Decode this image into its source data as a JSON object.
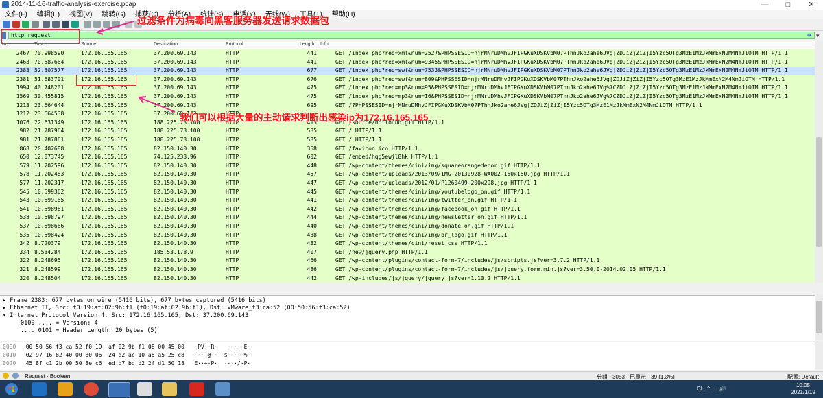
{
  "window": {
    "title": "2014-11-16-traffic-analysis-exercise.pcap",
    "controls": [
      "—",
      "□",
      "✕"
    ]
  },
  "menu": [
    "文件(F)",
    "编辑(E)",
    "视图(V)",
    "跳转(G)",
    "捕获(C)",
    "分析(A)",
    "统计(S)",
    "电话(Y)",
    "无线(W)",
    "工具(T)",
    "帮助(H)"
  ],
  "filter": {
    "value": "http request",
    "apply_icon": "arrow-right-icon",
    "dropdown_icon": "chevron-down-icon"
  },
  "columns": {
    "no": "No.",
    "time": "Time",
    "source": "Source",
    "destination": "Destination",
    "protocol": "Protocol",
    "length": "Length",
    "info": "Info"
  },
  "packets": [
    {
      "no": "2467",
      "time": "70.998590",
      "src": "172.16.165.165",
      "dst": "37.200.69.143",
      "proto": "HTTP",
      "len": "441",
      "info": "GET /index.php?req=xml&num=2527&PHPSSESID=njrMNruDMhvJFIPGKuXDSKVbM07PThnJko2ahe6JVg|ZDJiZjZiZjI5Yzc5OTg3MzE1MzJkMmExN2M4NmJiOTM HTTP/1.1"
    },
    {
      "no": "2463",
      "time": "70.587664",
      "src": "172.16.165.165",
      "dst": "37.200.69.143",
      "proto": "HTTP",
      "len": "441",
      "info": "GET /index.php?req=xml&num=9345&PHPSSESID=njrMNruDMhvJFIPGKuXDSKVbM07PThnJko2ahe6JVg|ZDJiZjZiZjI5Yzc5OTg3MzE1MzJkMmExN2M4NmJiOTM HTTP/1.1"
    },
    {
      "no": "2383",
      "time": "52.307577",
      "src": "172.16.165.165",
      "dst": "37.200.69.143",
      "proto": "HTTP",
      "len": "677",
      "info": "GET /index.php?req=swf&num=7533&PHPSSESID=njrMNruDMhvJFIPGKuXDSKVbM07PThnJko2ahe6JVg|ZDJiZjZiZjI5Yzc5OTg3MzE1MzJkMmExN2M4NmJiOTM HTTP/1.1"
    },
    {
      "no": "2381",
      "time": "51.683701",
      "src": "172.16.165.165",
      "dst": "37.200.69.143",
      "proto": "HTTP",
      "len": "676",
      "info": "GET /index.php?req=swf&num=809&PHPSSESID=njrMNruDMhvJFIPGKuXDSKVbM07PThnJko2ahe6JVg|ZDJiZjZiZjI5Yzc5OTg3MzE1MzJkMmExN2M4NmJiOTM HTTP/1.1"
    },
    {
      "no": "1994",
      "time": "40.748201",
      "src": "172.16.165.165",
      "dst": "37.200.69.143",
      "proto": "HTTP",
      "len": "475",
      "info": "GET /index.php?req=mp3&num=95&PHPSSESID=njrMNruDMhvJFIPGKuXDSKVbM07PThnJko2ahe6JVg%7CZDJiZjZiZjI5Yzc5OTg3MzE1MzJkMmExN2M4NmJiOTM HTTP/1.1"
    },
    {
      "no": "1569",
      "time": "30.455815",
      "src": "172.16.165.165",
      "dst": "37.200.69.143",
      "proto": "HTTP",
      "len": "475",
      "info": "GET /index.php?req=mp3&num=16&PHPSSESID=njrMNruDMhvJFIPGKuXDSKVbM07PThnJko2ahe6JVg%7CZDJiZjZiZjI5Yzc5OTg3MzE1MzJkMmExN2M4NmJiOTM HTTP/1.1"
    },
    {
      "no": "1213",
      "time": "23.664644",
      "src": "172.16.165.165",
      "dst": "37.200.69.143",
      "proto": "HTTP",
      "len": "695",
      "info": "GET /?PHPSSESID=njrMNruDMhvJFIPGKuXDSKVbM07PThnJko2ahe6JVg|ZDJiZjZiZjI5Yzc5OTg3MzE1MzJkMmExN2M4NmJiOTM HTTP/1.1"
    },
    {
      "no": "1212",
      "time": "23.664538",
      "src": "172.16.165.165",
      "dst": "37.200.69.143",
      "proto": "HTTP",
      "len": "",
      "info": ""
    },
    {
      "no": "1076",
      "time": "22.631349",
      "src": "172.16.165.165",
      "dst": "188.225.73.100",
      "proto": "HTTP",
      "len": "413",
      "info": "GET /source/notfound.gif HTTP/1.1"
    },
    {
      "no": "982",
      "time": "21.787964",
      "src": "172.16.165.165",
      "dst": "188.225.73.100",
      "proto": "HTTP",
      "len": "585",
      "info": "GET / HTTP/1.1"
    },
    {
      "no": "981",
      "time": "21.787861",
      "src": "172.16.165.165",
      "dst": "188.225.73.100",
      "proto": "HTTP",
      "len": "585",
      "info": "GET / HTTP/1.1"
    },
    {
      "no": "868",
      "time": "20.402688",
      "src": "172.16.165.165",
      "dst": "82.150.140.30",
      "proto": "HTTP",
      "len": "358",
      "info": "GET /favicon.ico HTTP/1.1"
    },
    {
      "no": "650",
      "time": "12.073745",
      "src": "172.16.165.165",
      "dst": "74.125.233.96",
      "proto": "HTTP",
      "len": "602",
      "info": "GET /embed/hqg5ewjl8hk HTTP/1.1"
    },
    {
      "no": "579",
      "time": "11.202596",
      "src": "172.16.165.165",
      "dst": "82.150.140.30",
      "proto": "HTTP",
      "len": "448",
      "info": "GET /wp-content/themes/cini/img/squareorangedecor.gif HTTP/1.1"
    },
    {
      "no": "578",
      "time": "11.202483",
      "src": "172.16.165.165",
      "dst": "82.150.140.30",
      "proto": "HTTP",
      "len": "457",
      "info": "GET /wp-content/uploads/2013/09/IMG-20130928-WA002-150x150.jpg HTTP/1.1"
    },
    {
      "no": "577",
      "time": "11.202317",
      "src": "172.16.165.165",
      "dst": "82.150.140.30",
      "proto": "HTTP",
      "len": "447",
      "info": "GET /wp-content/uploads/2012/01/P1260499-200x298.jpg HTTP/1.1"
    },
    {
      "no": "545",
      "time": "10.599362",
      "src": "172.16.165.165",
      "dst": "82.150.140.30",
      "proto": "HTTP",
      "len": "445",
      "info": "GET /wp-content/themes/cini/img/youtubelogo_on.gif HTTP/1.1"
    },
    {
      "no": "543",
      "time": "10.599165",
      "src": "172.16.165.165",
      "dst": "82.150.140.30",
      "proto": "HTTP",
      "len": "441",
      "info": "GET /wp-content/themes/cini/img/twitter_on.gif HTTP/1.1"
    },
    {
      "no": "541",
      "time": "10.598981",
      "src": "172.16.165.165",
      "dst": "82.150.140.30",
      "proto": "HTTP",
      "len": "442",
      "info": "GET /wp-content/themes/cini/img/facebook_on.gif HTTP/1.1"
    },
    {
      "no": "538",
      "time": "10.598797",
      "src": "172.16.165.165",
      "dst": "82.150.140.30",
      "proto": "HTTP",
      "len": "444",
      "info": "GET /wp-content/themes/cini/img/newsletter_on.gif HTTP/1.1"
    },
    {
      "no": "537",
      "time": "10.598666",
      "src": "172.16.165.165",
      "dst": "82.150.140.30",
      "proto": "HTTP",
      "len": "440",
      "info": "GET /wp-content/themes/cini/img/donate_on.gif HTTP/1.1"
    },
    {
      "no": "535",
      "time": "10.598424",
      "src": "172.16.165.165",
      "dst": "82.150.140.30",
      "proto": "HTTP",
      "len": "438",
      "info": "GET /wp-content/themes/cini/img/br_logo.gif HTTP/1.1"
    },
    {
      "no": "342",
      "time": "8.720379",
      "src": "172.16.165.165",
      "dst": "82.150.140.30",
      "proto": "HTTP",
      "len": "432",
      "info": "GET /wp-content/themes/cini/reset.css HTTP/1.1"
    },
    {
      "no": "334",
      "time": "8.534284",
      "src": "172.16.165.165",
      "dst": "185.53.178.9",
      "proto": "HTTP",
      "len": "407",
      "info": "GET /new/jquery.php HTTP/1.1"
    },
    {
      "no": "322",
      "time": "8.248695",
      "src": "172.16.165.165",
      "dst": "82.150.140.30",
      "proto": "HTTP",
      "len": "466",
      "info": "GET /wp-content/plugins/contact-form-7/includes/js/scripts.js?ver=3.7.2 HTTP/1.1"
    },
    {
      "no": "321",
      "time": "8.248599",
      "src": "172.16.165.165",
      "dst": "82.150.140.30",
      "proto": "HTTP",
      "len": "486",
      "info": "GET /wp-content/plugins/contact-form-7/includes/js/jquery.form.min.js?ver=3.50.0-2014.02.05 HTTP/1.1"
    },
    {
      "no": "320",
      "time": "8.248504",
      "src": "172.16.165.165",
      "dst": "82.150.140.30",
      "proto": "HTTP",
      "len": "442",
      "info": "GET /wp-includes/js/jquery/jquery.js?ver=1.10.2 HTTP/1.1"
    }
  ],
  "selected_index": 2,
  "details": [
    "Frame 2383: 677 bytes on wire (5416 bits), 677 bytes captured (5416 bits)",
    "Ethernet II, Src: f0:19:af:02:9b:f1 (f0:19:af:02:9b:f1), Dst: VMware_f3:ca:52 (00:50:56:f3:ca:52)",
    "Internet Protocol Version 4, Src: 172.16.165.165, Dst: 37.200.69.143",
    "0100 .... = Version: 4",
    ".... 0101 = Header Length: 20 bytes (5)"
  ],
  "hex": [
    {
      "offset": "0000",
      "bytes": "00 50 56 f3 ca 52 f0 19  af 02 9b f1 08 00 45 00",
      "ascii": "·PV··R·· ······E·"
    },
    {
      "offset": "0010",
      "bytes": "02 97 16 82 40 00 80 06  24 d2 ac 10 a5 a5 25 c8",
      "ascii": "····@··· $·····%·"
    },
    {
      "offset": "0020",
      "bytes": "45 8f c1 2b 00 50 8e c6  ed d7 bd d2 2f d1 50 18",
      "ascii": "E··+·P·· ····/·P·"
    }
  ],
  "status": {
    "field": "Request · Boolean",
    "packets": "分组 · 3053 · 已显示 · 39 (1.3%)",
    "profile": "配置: Default"
  },
  "clock": {
    "time": "10:05",
    "date": "2021/1/19"
  },
  "tray": "CH  ⌃  ▭  🔊",
  "annotations": {
    "top": "过滤条件为病毒向黑客服务器发送请求数据包",
    "middle": "我们可以根据大量的主动请求判断出感染ip为172.16.165.165"
  },
  "colors": {
    "filter_ok": "#afffaf",
    "http_row": "#e4ffc7",
    "selected_row": "#c9e3ff",
    "annotation": "#ff1010"
  }
}
